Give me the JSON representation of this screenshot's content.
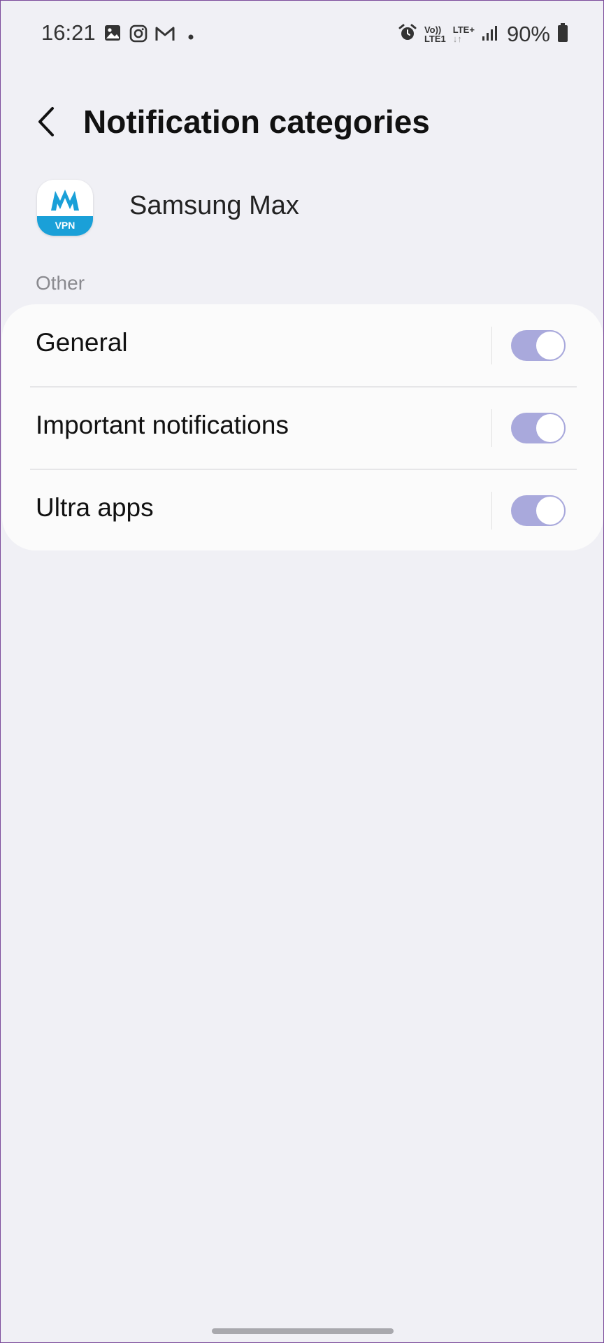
{
  "status_bar": {
    "time": "16:21",
    "left_icons": [
      "gallery-icon",
      "instagram-icon",
      "gmail-icon",
      "dot-icon"
    ],
    "volte_label": "Vo))",
    "lte1_label": "LTE1",
    "lte_plus_label": "LTE+",
    "battery": "90%"
  },
  "header": {
    "back_icon": "chevron-left-icon",
    "title": "Notification categories"
  },
  "app": {
    "name": "Samsung Max",
    "icon_badge": "VPN",
    "brand_color": "#1aa0d8"
  },
  "section": {
    "label": "Other"
  },
  "categories": [
    {
      "label": "General",
      "enabled": true
    },
    {
      "label": "Important notifications",
      "enabled": true
    },
    {
      "label": "Ultra apps",
      "enabled": true
    }
  ],
  "colors": {
    "toggle_on": "#a9a9dc",
    "background": "#f0f0f5",
    "card": "#fbfbfb"
  }
}
